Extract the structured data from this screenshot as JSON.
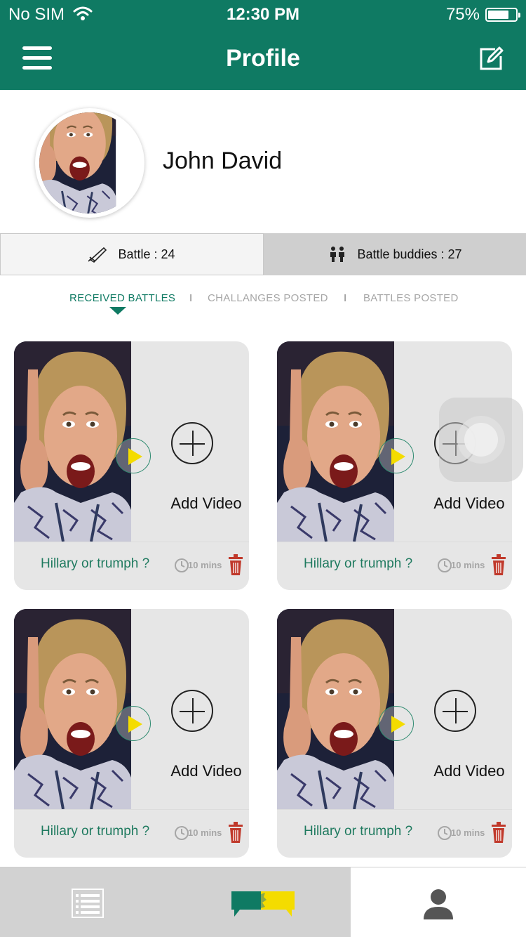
{
  "status_bar": {
    "carrier": "No SIM",
    "time": "12:30 PM",
    "battery_percent": "75%",
    "battery_level": 0.75
  },
  "nav": {
    "title": "Profile",
    "left_icon": "menu-icon",
    "right_icon": "edit-icon"
  },
  "profile": {
    "name": "John David"
  },
  "stats": {
    "battle_label": "Battle : 24",
    "buddies_label": "Battle buddies : 27"
  },
  "tabs": [
    {
      "label": "RECEIVED BATTLES",
      "active": true
    },
    {
      "label": "CHALLANGES POSTED",
      "active": false
    },
    {
      "label": "BATTLES POSTED",
      "active": false
    }
  ],
  "tab_separator": "I",
  "cards": [
    {
      "title": "Hillary or trumph ?",
      "duration": "10 mins",
      "add_label": "Add Video"
    },
    {
      "title": "Hillary or trumph ?",
      "duration": "10 mins",
      "add_label": "Add Video"
    },
    {
      "title": "Hillary or trumph ?",
      "duration": "10 mins",
      "add_label": "Add Video"
    },
    {
      "title": "Hillary or trumph ?",
      "duration": "10 mins",
      "add_label": "Add Video"
    }
  ],
  "tabbar": {
    "items": [
      "list-icon",
      "battle-chat-icon",
      "profile-icon"
    ],
    "selected": 2
  },
  "colors": {
    "primary": "#0f7a63",
    "accent_yellow": "#f4dc00",
    "trash_red": "#c0392b",
    "card_bg": "#e6e6e6"
  }
}
